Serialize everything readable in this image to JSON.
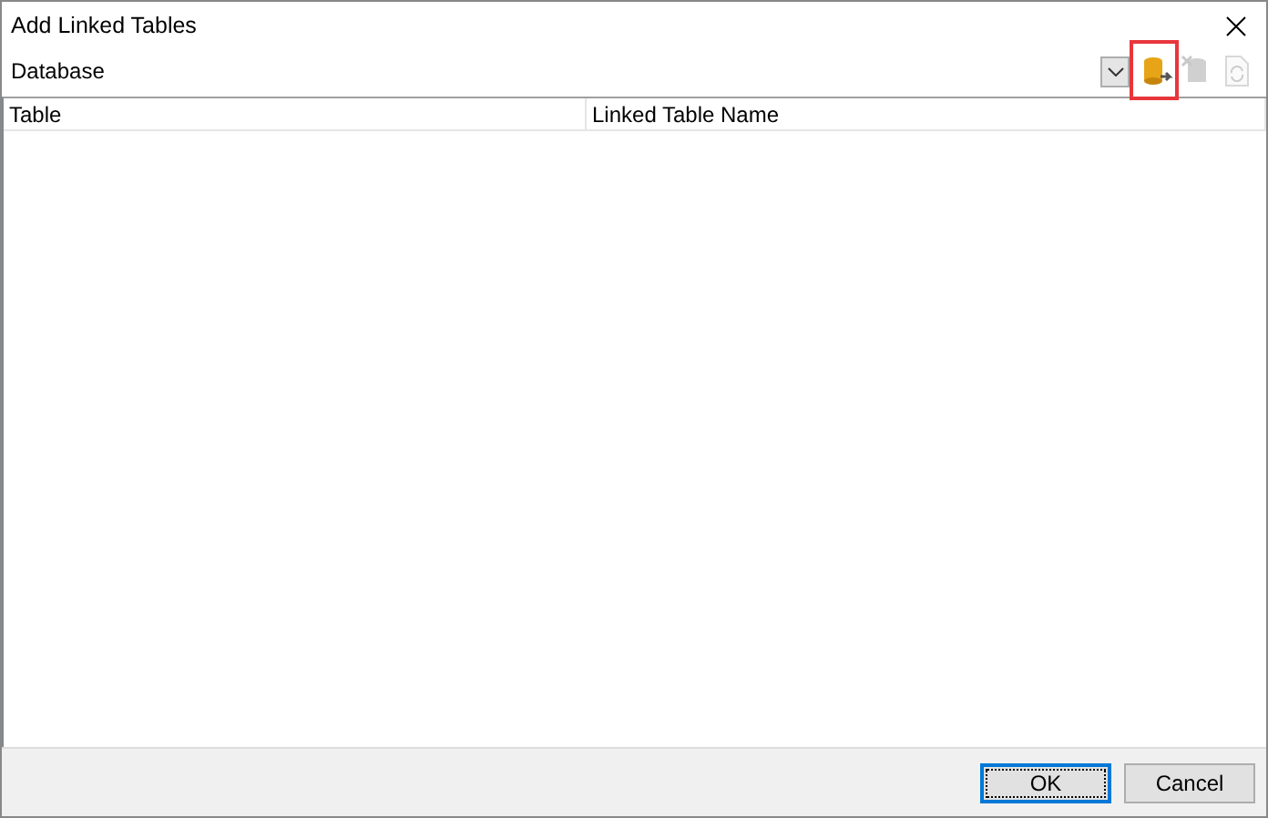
{
  "window": {
    "title": "Add Linked Tables"
  },
  "toolbar": {
    "label": "Database",
    "tools": [
      {
        "kind": "add",
        "disabled": false,
        "highlighted": true
      },
      {
        "kind": "remove",
        "disabled": true,
        "highlighted": false
      },
      {
        "kind": "refresh",
        "disabled": true,
        "highlighted": false
      }
    ]
  },
  "table": {
    "columns": [
      "Table",
      "Linked Table Name"
    ]
  },
  "buttons": [
    {
      "label": "OK",
      "default": true
    },
    {
      "label": "Cancel",
      "default": false
    }
  ]
}
